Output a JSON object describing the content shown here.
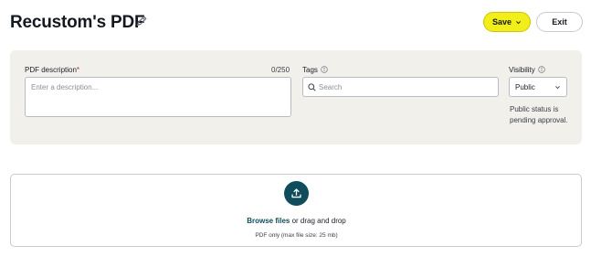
{
  "header": {
    "title": "Recustom's PDF",
    "save_label": "Save",
    "exit_label": "Exit"
  },
  "form": {
    "description": {
      "label": "PDF description",
      "required_mark": "*",
      "counter": "0/250",
      "value": "",
      "placeholder": "Enter a description..."
    },
    "tags": {
      "label": "Tags",
      "value": "",
      "placeholder": "Search"
    },
    "visibility": {
      "label": "Visibility",
      "selected": "Public",
      "note": "Public status is pending approval."
    }
  },
  "upload": {
    "browse_label": "Browse files",
    "drag_text": " or drag and drop",
    "subtext": "PDF only (max file size: 25 mb)"
  },
  "icons": {
    "edit": "pencil-icon",
    "chevron": "chevron-down-icon",
    "info": "info-icon",
    "search": "search-icon",
    "upload": "upload-icon"
  },
  "colors": {
    "save_button": "#f2ee1a",
    "panel_background": "#f1f0ea",
    "upload_button": "#0f4c5c",
    "required_mark": "#c0282b"
  }
}
